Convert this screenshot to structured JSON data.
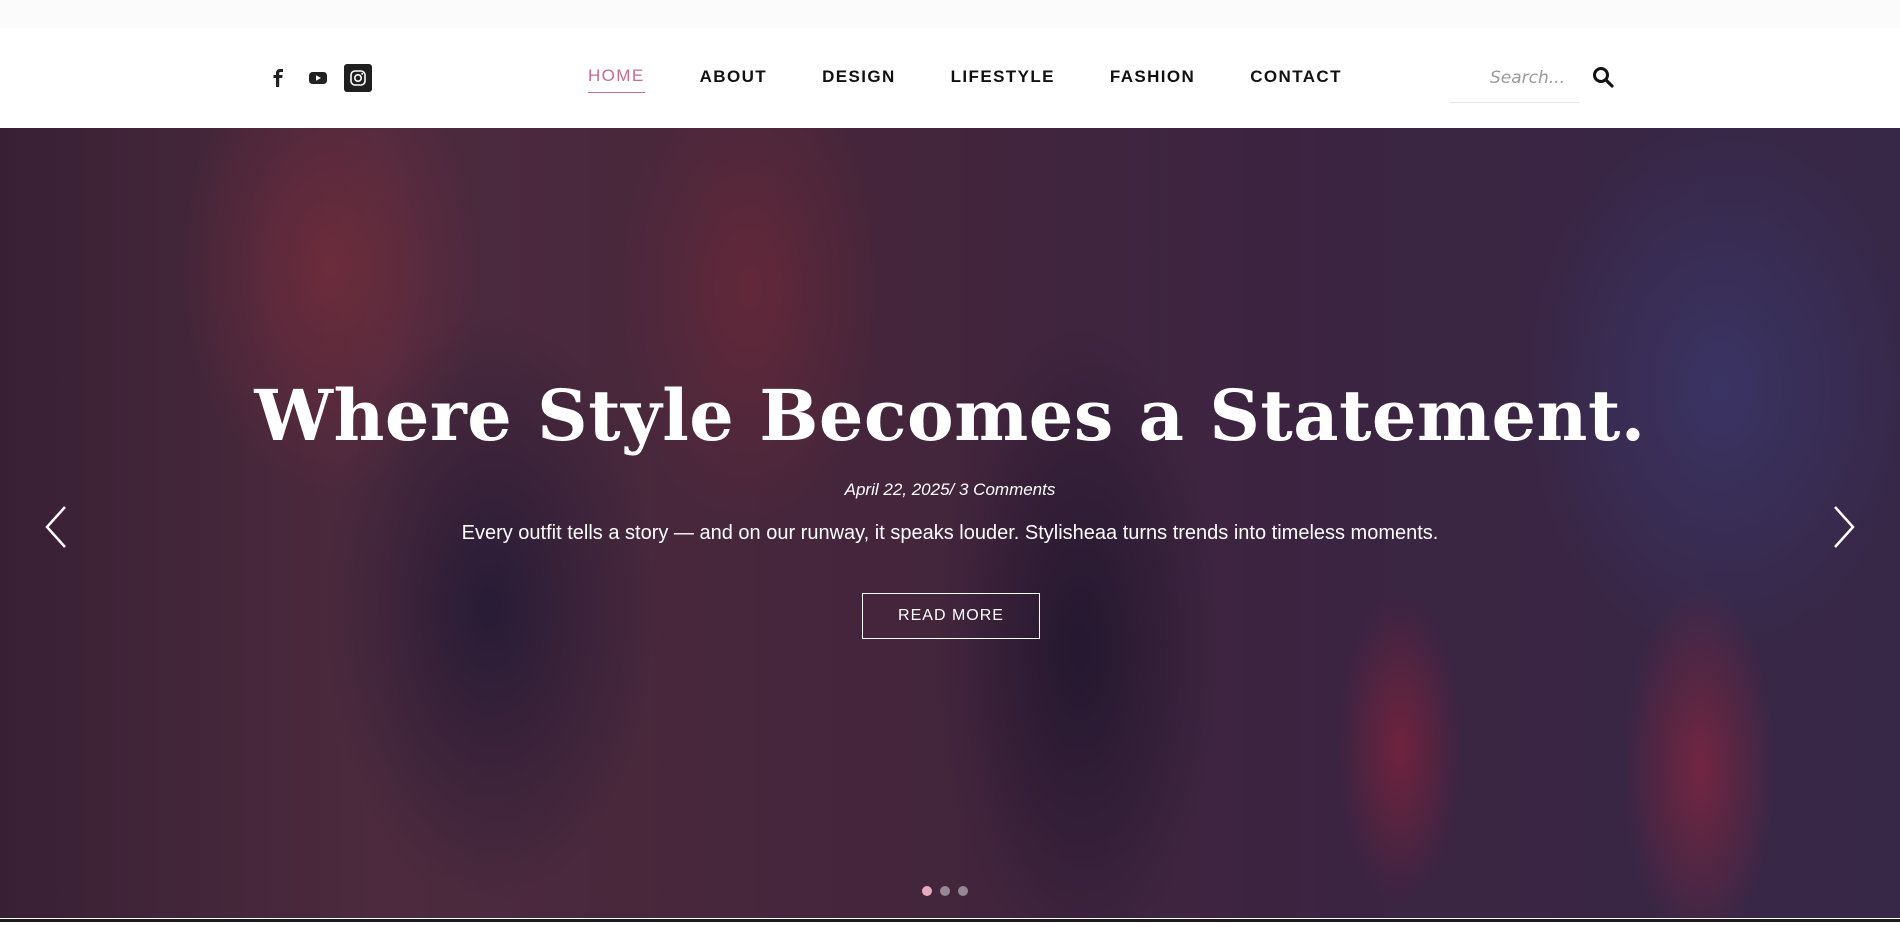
{
  "header": {
    "social": [
      {
        "name": "facebook-icon"
      },
      {
        "name": "youtube-icon"
      },
      {
        "name": "instagram-icon"
      }
    ],
    "nav": [
      {
        "label": "HOME",
        "active": true
      },
      {
        "label": "ABOUT"
      },
      {
        "label": "DESIGN"
      },
      {
        "label": "LIFESTYLE"
      },
      {
        "label": "FASHION"
      },
      {
        "label": "CONTACT"
      }
    ],
    "search": {
      "placeholder": "Search...",
      "icon": "search-icon"
    }
  },
  "hero": {
    "title": "Where Style Becomes a Statement.",
    "meta": "April 22, 2025/ 3 Comments",
    "description": "Every outfit tells a story — and on our runway, it speaks louder. Stylisheaa turns trends into timeless moments.",
    "button_label": "READ MORE",
    "slide_count": 3,
    "active_slide": 1
  },
  "colors": {
    "accent": "#c86b8e",
    "dot_active": "#e9a9c1",
    "text_dark": "#111111"
  }
}
